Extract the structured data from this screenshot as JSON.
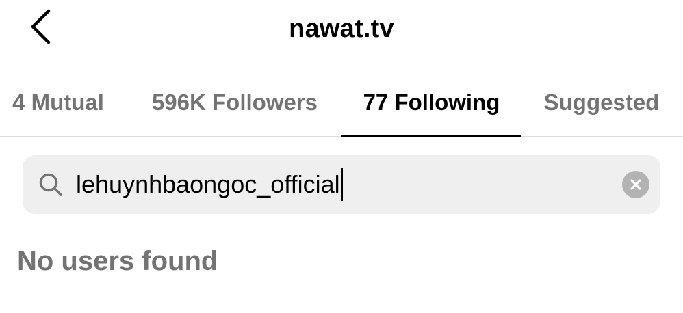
{
  "header": {
    "title": "nawat.tv",
    "back_icon": "chevron-left-icon"
  },
  "tabs": [
    {
      "label": "4 Mutual",
      "active": false
    },
    {
      "label": "596K Followers",
      "active": false
    },
    {
      "label": "77 Following",
      "active": true
    },
    {
      "label": "Suggested",
      "active": false
    }
  ],
  "search": {
    "value": "lehuynhbaongoc_official",
    "icon": "search-icon",
    "clear_icon": "clear-icon"
  },
  "results": {
    "empty_message": "No users found"
  },
  "colors": {
    "text_primary": "#000000",
    "text_secondary": "#737373",
    "search_background": "#efefef",
    "divider": "#dbdbdb",
    "clear_button": "#b3b3b3"
  }
}
